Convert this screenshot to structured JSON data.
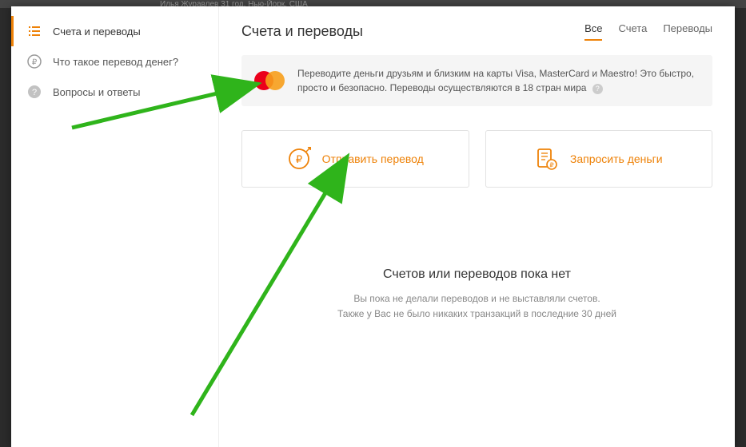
{
  "bg_hint": "Илья Журавлев  31 год, Нью-Йорк, США",
  "sidebar": {
    "items": [
      {
        "label": "Счета и переводы",
        "icon": "list-icon",
        "active": true
      },
      {
        "label": "Что такое перевод денег?",
        "icon": "ruble-icon",
        "active": false
      },
      {
        "label": "Вопросы и ответы",
        "icon": "help-icon",
        "active": false
      }
    ]
  },
  "header": {
    "title": "Счета и переводы",
    "tabs": [
      {
        "label": "Все",
        "active": true
      },
      {
        "label": "Счета",
        "active": false
      },
      {
        "label": "Переводы",
        "active": false
      }
    ]
  },
  "banner": {
    "text": "Переводите деньги друзьям и близким на карты Visa, MasterCard и Maestro! Это быстро, просто и безопасно. Переводы осуществляются в 18 стран мира"
  },
  "actions": {
    "send": "Отправить перевод",
    "request": "Запросить деньги"
  },
  "empty": {
    "title": "Счетов или переводов пока нет",
    "line1": "Вы пока не делали переводов и не выставляли счетов.",
    "line2": "Также у Вас не было никаких транзакций в последние 30 дней"
  },
  "colors": {
    "accent": "#ee8208",
    "arrow": "#2fb41b"
  }
}
